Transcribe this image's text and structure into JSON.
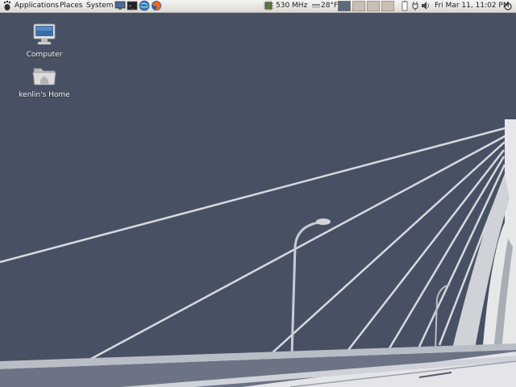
{
  "panel": {
    "menus": [
      {
        "label": "Applications"
      },
      {
        "label": "Places"
      },
      {
        "label": "System"
      }
    ],
    "launchers": [
      "monitor-icon",
      "terminal-icon",
      "globe-icon",
      "firefox-icon"
    ],
    "cpu_freq": "530 MHz",
    "weather_temp": "28°F",
    "clock": "Fri Mar 11, 11:02 PM",
    "workspace_count": 4,
    "active_workspace": 0
  },
  "desktop": {
    "icons": [
      {
        "label": "Computer",
        "icon": "computer-icon"
      },
      {
        "label": "kenlin's Home",
        "icon": "home-folder-icon"
      }
    ]
  },
  "colors": {
    "wallpaper": "#485164",
    "panel": "#e8e6e1",
    "bridge": "#e6e7e9"
  }
}
